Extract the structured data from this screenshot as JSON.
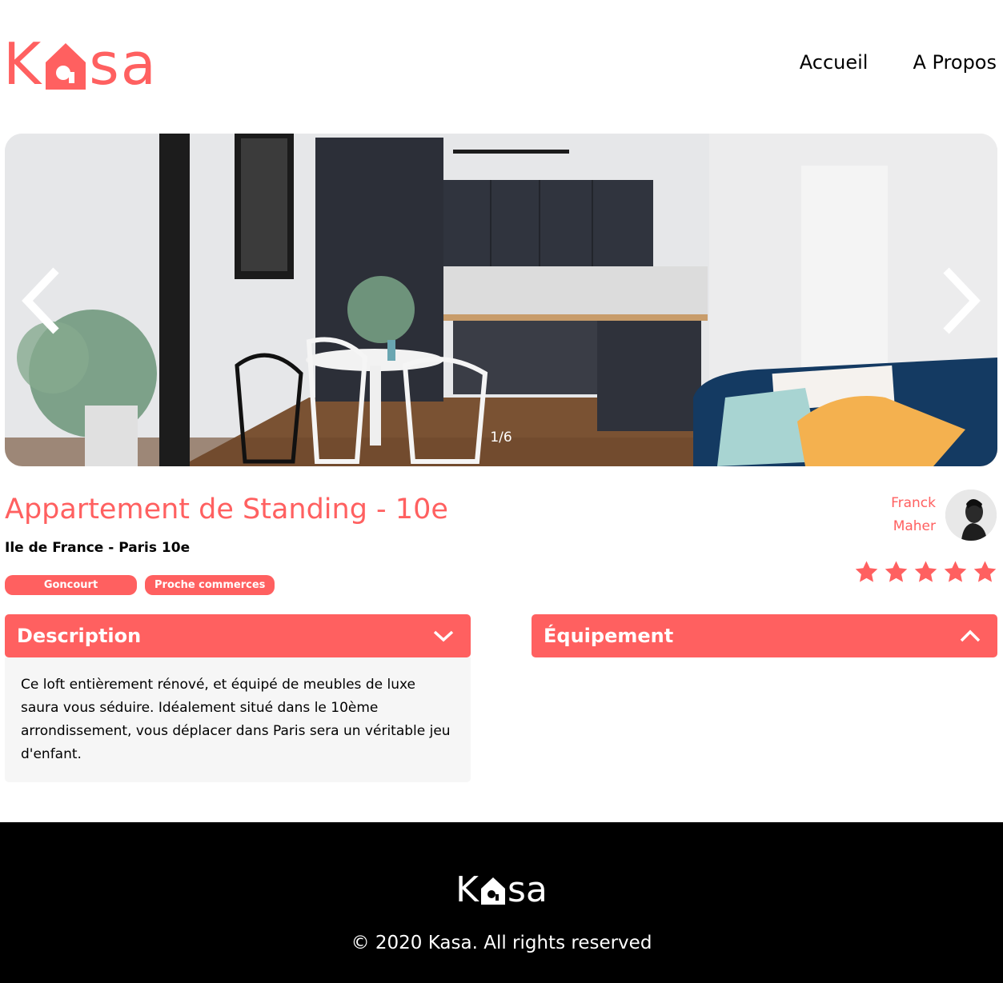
{
  "brand": {
    "name_part1": "K",
    "name_part2": "sa",
    "color": "#FF6060"
  },
  "nav": {
    "home": "Accueil",
    "about": "A Propos"
  },
  "carousel": {
    "counter": "1/6",
    "current": 1,
    "total": 6,
    "prev_icon": "chevron-left-icon",
    "next_icon": "chevron-right-icon"
  },
  "listing": {
    "title": "Appartement de Standing - 10e",
    "location": "Ile de France - Paris 10e",
    "tags": [
      "Goncourt",
      "Proche commerces"
    ],
    "rating": 5,
    "rating_max": 5
  },
  "host": {
    "first_name": "Franck",
    "last_name": "Maher"
  },
  "collapses": {
    "description": {
      "title": "Description",
      "text": "Ce loft entièrement rénové, et équipé de meubles de luxe saura vous séduire. Idéalement situé dans le 10ème arrondissement, vous déplacer dans Paris sera un véritable jeu d'enfant.",
      "icon": "chevron-down-icon"
    },
    "equipment": {
      "title": "Équipement",
      "icon": "chevron-up-icon"
    }
  },
  "footer": {
    "copyright": "© 2020 Kasa. All rights reserved",
    "background": "#000000"
  }
}
